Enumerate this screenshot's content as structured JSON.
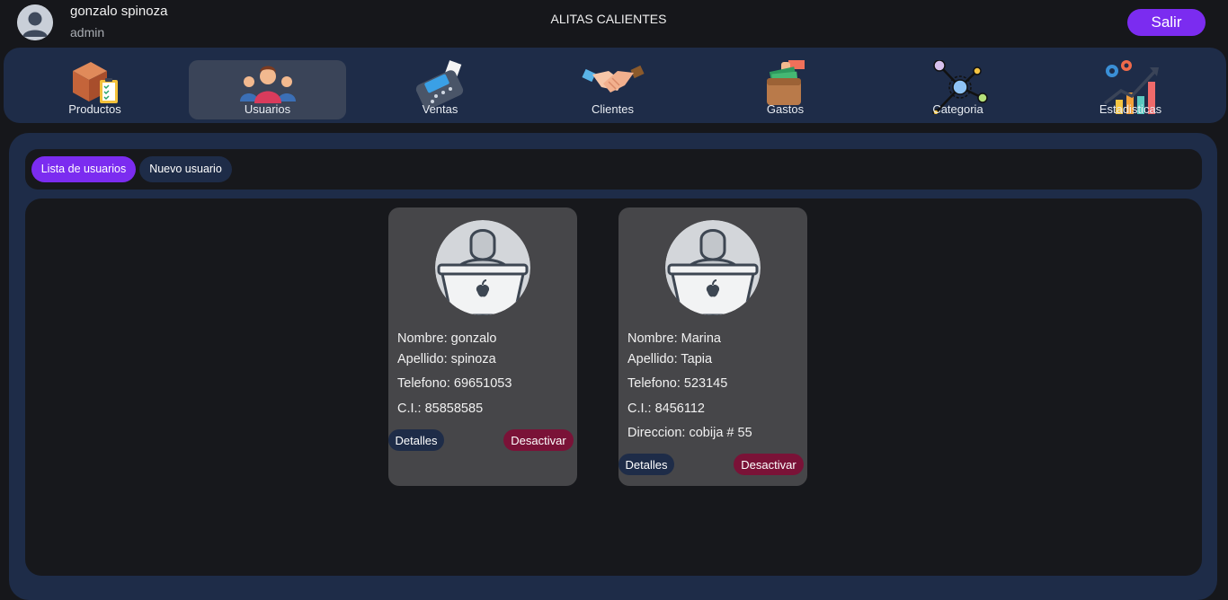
{
  "header": {
    "user_name": "gonzalo spinoza",
    "user_role": "admin",
    "title": "ALITAS CALIENTES",
    "logout_label": "Salir"
  },
  "nav": {
    "items": [
      {
        "label": "Productos",
        "icon": "box-clipboard-icon"
      },
      {
        "label": "Usuarios",
        "icon": "users-group-icon",
        "active": true
      },
      {
        "label": "Ventas",
        "icon": "card-terminal-icon"
      },
      {
        "label": "Clientes",
        "icon": "handshake-icon"
      },
      {
        "label": "Gastos",
        "icon": "wallet-money-icon"
      },
      {
        "label": "Categoria",
        "icon": "network-nodes-icon"
      },
      {
        "label": "Estadisticas",
        "icon": "growth-chart-icon"
      }
    ]
  },
  "tabs": {
    "list_label": "Lista de usuarios",
    "new_label": "Nuevo usuario"
  },
  "users": [
    {
      "nombre": "Nombre: gonzalo",
      "apellido": "Apellido: spinoza",
      "telefono": "Telefono: 69651053",
      "ci": "C.I.: 85858585",
      "detalles_label": "Detalles",
      "desactivar_label": "Desactivar"
    },
    {
      "nombre": "Nombre: Marina",
      "apellido": "Apellido: Tapia",
      "telefono": "Telefono: 523145",
      "ci": "C.I.: 8456112",
      "direccion": "Direccion: cobija # 55",
      "detalles_label": "Detalles",
      "desactivar_label": "Desactivar"
    }
  ],
  "colors": {
    "accent": "#7b2cf0",
    "nav_bg": "#1e2c48",
    "danger": "#7a1237",
    "card_bg": "#464649"
  }
}
